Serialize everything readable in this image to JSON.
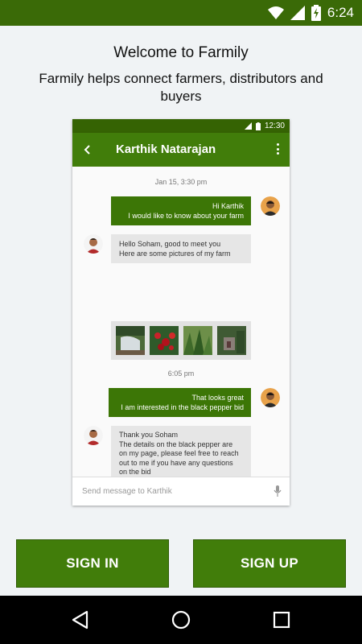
{
  "status_bar": {
    "time": "6:24"
  },
  "welcome": {
    "title": "Welcome to Farmily",
    "subtitle": "Farmily helps connect farmers, distributors and buyers"
  },
  "preview": {
    "status_time": "12:30",
    "contact_name": "Karthik Natarajan",
    "timestamps": [
      "Jan 15, 3:30 pm",
      "6:05 pm"
    ],
    "messages": [
      {
        "direction": "out",
        "lines": [
          "Hi Karthik",
          "I would like to know about your farm"
        ]
      },
      {
        "direction": "in",
        "lines": [
          "Hello Soham, good to meet you",
          "Here are some pictures of my farm"
        ]
      },
      {
        "direction": "out",
        "lines": [
          "That looks great",
          "I am interested in the black pepper bid"
        ]
      },
      {
        "direction": "in",
        "lines": [
          "Thank you Soham",
          "The details on the black pepper are",
          "on my page, please feel free to reach",
          "out to me if you have any questions",
          "on the bid"
        ]
      }
    ],
    "input_placeholder": "Send message to Karthik"
  },
  "buttons": {
    "sign_in": "SIGN IN",
    "sign_up": "SIGN UP"
  },
  "colors": {
    "brand_green": "#417d0a",
    "status_green": "#3a6a07",
    "bubble_in": "#e6e6e6"
  }
}
